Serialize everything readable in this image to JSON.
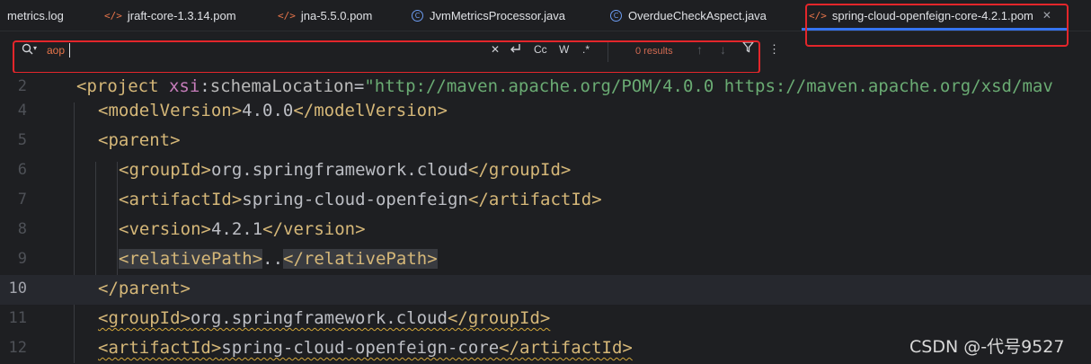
{
  "tabs": [
    {
      "label": "metrics.log",
      "icon": "none"
    },
    {
      "label": "jraft-core-1.3.14.pom",
      "icon": "xml-file-icon"
    },
    {
      "label": "jna-5.5.0.pom",
      "icon": "xml-file-icon"
    },
    {
      "label": "JvmMetricsProcessor.java",
      "icon": "java-class-icon"
    },
    {
      "label": "OverdueCheckAspect.java",
      "icon": "java-class-icon"
    },
    {
      "label": "spring-cloud-openfeign-core-4.2.1.pom",
      "icon": "xml-file-icon",
      "active": true
    }
  ],
  "icons": {
    "xml": "</>",
    "java": "C",
    "close": "✕"
  },
  "search": {
    "value": "aop",
    "results": "0 results",
    "case_label": "Cc",
    "word_label": "W",
    "regex_label": ".*"
  },
  "editor": {
    "current_line": "10",
    "lines": [
      {
        "num": "2"
      },
      {
        "num": "4"
      },
      {
        "num": "5"
      },
      {
        "num": "6"
      },
      {
        "num": "7"
      },
      {
        "num": "8"
      },
      {
        "num": "9"
      },
      {
        "num": "10"
      },
      {
        "num": "11"
      },
      {
        "num": "12"
      }
    ],
    "tokens": {
      "l2": {
        "open": "<project ",
        "ns": "xsi",
        "colon": ":",
        "attr": "schemaLocation",
        "eq": "=",
        "val": "\"http://maven.apache.org/POM/4.0.0 https://maven.apache.org/xsd/mav"
      },
      "l4": {
        "open": "<modelVersion>",
        "text": "4.0.0",
        "close": "</modelVersion>"
      },
      "l5": {
        "open": "<parent>"
      },
      "l6": {
        "open": "<groupId>",
        "text": "org.springframework.cloud",
        "close": "</groupId>"
      },
      "l7": {
        "open": "<artifactId>",
        "text": "spring-cloud-openfeign",
        "close": "</artifactId>"
      },
      "l8": {
        "open": "<version>",
        "text": "4.2.1",
        "close": "</version>"
      },
      "l9": {
        "open": "<relativePath>",
        "text": "..",
        "close": "</relativePath>"
      },
      "l10": {
        "close": "</parent>"
      },
      "l11": {
        "open": "<groupId>",
        "text": "org.springframework.cloud",
        "close": "</groupId>"
      },
      "l12": {
        "open": "<artifactId>",
        "text": "spring-cloud-openfeign-core",
        "close": "</artifactId>"
      }
    }
  },
  "watermark": "CSDN @-代号9527",
  "colors": {
    "accent": "#3574f0",
    "annotation": "#e3262b",
    "tag": "#d5b778",
    "string": "#6aab73",
    "namespace": "#c77dbb"
  }
}
